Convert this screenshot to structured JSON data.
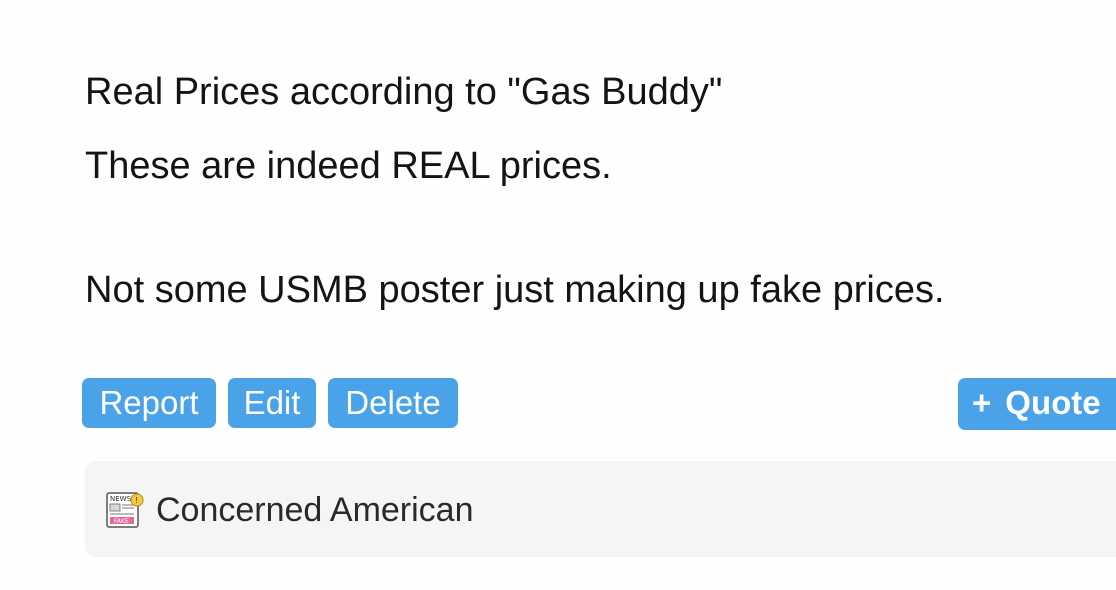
{
  "post": {
    "lines": [
      "Real Prices according to \"Gas Buddy\"",
      "These are indeed REAL prices.",
      "Not some USMB poster just making up fake prices."
    ]
  },
  "actions": {
    "report_label": "Report",
    "edit_label": "Edit",
    "delete_label": "Delete",
    "quote_label": "Quote",
    "quote_icon": "plus-icon"
  },
  "signature": {
    "icon": "fake-news-icon",
    "text": "Concerned American"
  },
  "colors": {
    "button": "#4aa3e8",
    "signature_bg": "#f5f5f5"
  }
}
